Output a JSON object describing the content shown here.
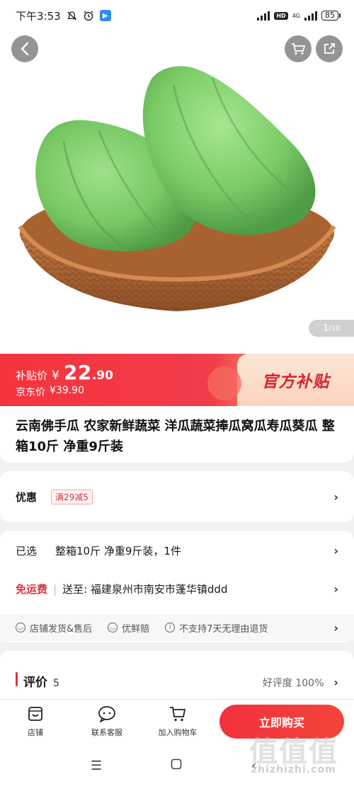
{
  "status_bar": {
    "time": "下午3:53",
    "network": "4G",
    "hd": "HD",
    "battery": "85"
  },
  "hero": {
    "page_current": "1",
    "page_total": "/10"
  },
  "price": {
    "subsidy_label": "补贴价",
    "yen": "¥",
    "integer": "22",
    "decimal": ".90",
    "jd_label": "京东价",
    "jd_price": "¥39.90",
    "badge": "官方补贴"
  },
  "product": {
    "title": "云南佛手瓜 农家新鲜蔬菜 洋瓜蔬菜捧瓜窝瓜寿瓜葵瓜 整箱10斤 净重9斤装"
  },
  "offers": {
    "label": "优惠",
    "coupon": "满29减5"
  },
  "selection": {
    "label": "已选",
    "value": "整箱10斤 净重9斤装，1件"
  },
  "shipping": {
    "label": "免运费",
    "divider": "|",
    "value": "送至: 福建泉州市南安市蓬华镇ddd"
  },
  "guarantees": [
    "店铺发货&售后",
    "优鲜赔",
    "不支持7天无理由退货"
  ],
  "reviews": {
    "label": "评价",
    "count": "5",
    "rate": "好评度 100%"
  },
  "bottom_bar": {
    "shop": "店铺",
    "service": "联系客服",
    "cart": "加入购物车",
    "buy": "立即购买"
  },
  "watermark": {
    "logo": "值值值",
    "url": "zhizhizhi.com"
  }
}
